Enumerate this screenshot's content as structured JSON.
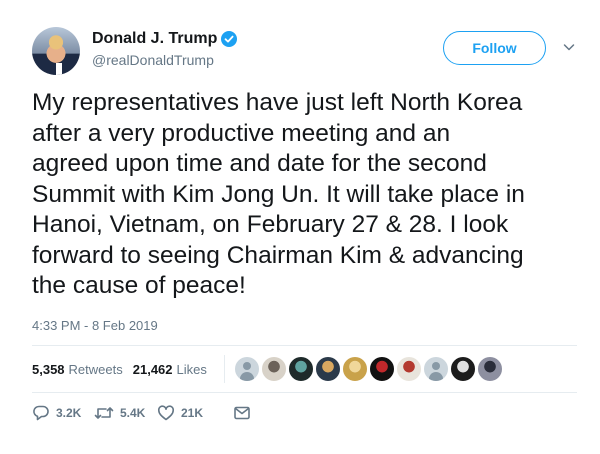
{
  "user": {
    "display_name": "Donald J. Trump",
    "handle": "@realDonaldTrump",
    "verified": true
  },
  "follow_label": "Follow",
  "tweet": {
    "text": "My representatives have just left North Korea\nafter a very productive meeting and an\nagreed upon time and date for the second\nSummit with Kim Jong Un. It will take place in\nHanoi, Vietnam, on February 27 & 28. I look\nforward to seeing Chairman Kim & advancing\nthe cause of peace!",
    "timestamp": "4:33 PM - 8 Feb 2019"
  },
  "stats": {
    "retweets_count": "5,358",
    "retweets_label": "Retweets",
    "likes_count": "21,462",
    "likes_label": "Likes"
  },
  "likers": [
    {
      "style": "default"
    },
    {
      "colors": [
        "#d8d2c8",
        "#6b6259"
      ]
    },
    {
      "colors": [
        "#1e2a2a",
        "#5fa3a0"
      ]
    },
    {
      "colors": [
        "#2b3a4a",
        "#d9a860"
      ]
    },
    {
      "colors": [
        "#c9a24a",
        "#f0d79a"
      ]
    },
    {
      "colors": [
        "#111111",
        "#c0282b"
      ]
    },
    {
      "colors": [
        "#e8e4dc",
        "#b3392f"
      ]
    },
    {
      "style": "default"
    },
    {
      "colors": [
        "#1c1c1c",
        "#e0e0e0"
      ]
    },
    {
      "colors": [
        "#8d8fa0",
        "#2a2d3a"
      ]
    }
  ],
  "actions": {
    "reply_count": "3.2K",
    "retweet_count": "5.4K",
    "like_count": "21K"
  },
  "colors": {
    "accent": "#1da1f2",
    "text": "#14171a",
    "muted": "#657786"
  },
  "icons": [
    "verified-badge-icon",
    "chevron-down-icon",
    "reply-icon",
    "retweet-icon",
    "heart-icon",
    "direct-message-icon"
  ]
}
